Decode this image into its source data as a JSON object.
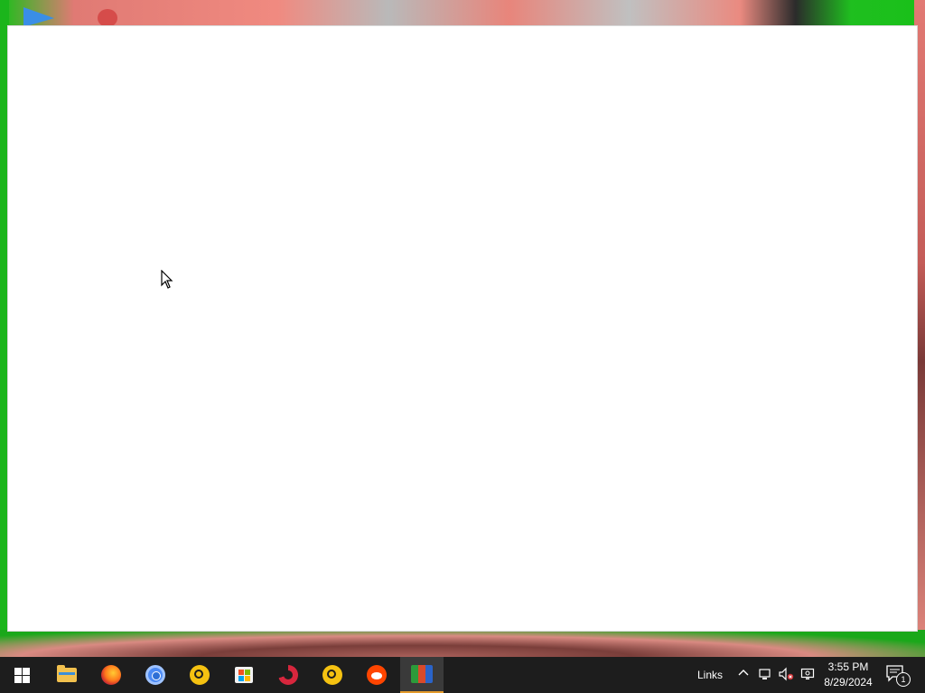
{
  "taskbar": {
    "start_icon": "windows-start-icon",
    "pinned": [
      {
        "name": "file-explorer-icon"
      },
      {
        "name": "firefox-icon"
      },
      {
        "name": "chrome-icon"
      },
      {
        "name": "app-yellow-icon"
      },
      {
        "name": "microsoft-store-icon"
      },
      {
        "name": "ccleaner-icon"
      },
      {
        "name": "app-yellow-2-icon"
      },
      {
        "name": "reddit-icon"
      },
      {
        "name": "active-app-icon"
      }
    ],
    "tray": {
      "links_label": "Links",
      "time": "3:55 PM",
      "date": "8/29/2024",
      "notification_count": "1"
    }
  },
  "colors": {
    "taskbar_bg": "#1d1d1d",
    "window_bg": "#ffffff",
    "active_indicator": "#e39a2a"
  }
}
